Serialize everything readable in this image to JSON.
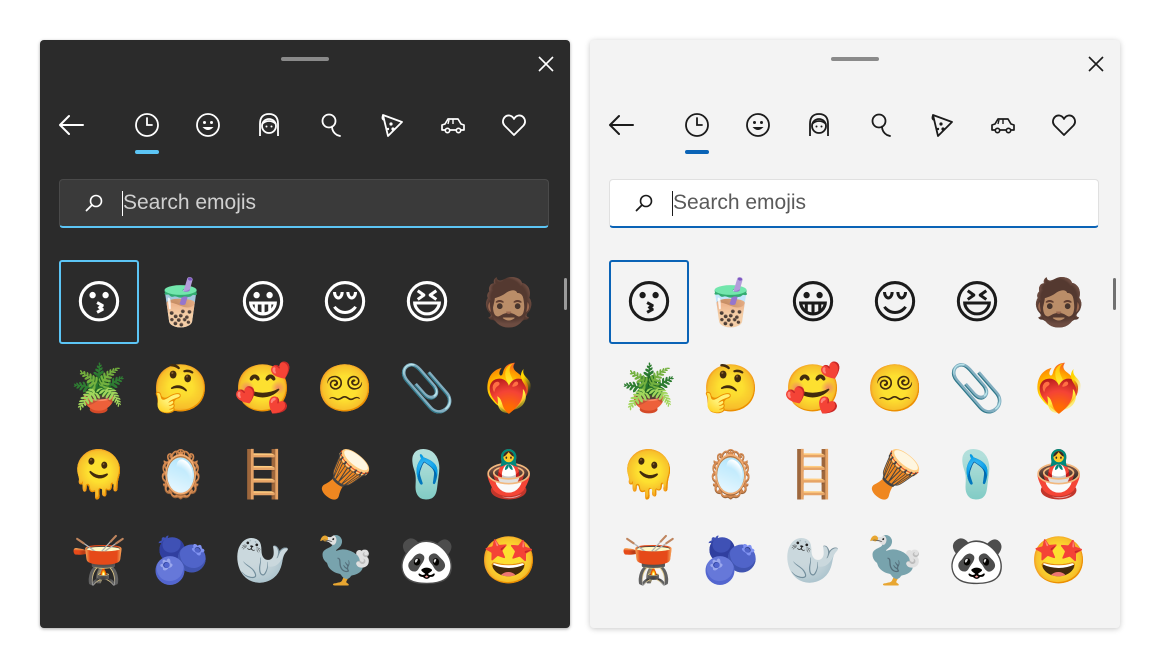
{
  "search": {
    "placeholder": "Search emojis"
  },
  "tabs": [
    {
      "icon": "recent-clock-icon",
      "selected": true
    },
    {
      "icon": "smiley-icon"
    },
    {
      "icon": "people-icon"
    },
    {
      "icon": "activities-icon"
    },
    {
      "icon": "food-icon"
    },
    {
      "icon": "travel-car-icon"
    },
    {
      "icon": "heart-symbols-icon"
    }
  ],
  "emojis": [
    "😗",
    "🧋",
    "😀",
    "😌",
    "😆",
    "🧔🏽",
    "🪴",
    "🤔",
    "🥰",
    "😵‍💫",
    "📎",
    "❤️‍🔥",
    "🫠",
    "🪞",
    "🪜",
    "🪘",
    "🩴",
    "🪆",
    "🫕",
    "🫐",
    "🦭",
    "🦤",
    "🐼",
    "🤩"
  ],
  "colors": {
    "dark_bg": "#2b2b2b",
    "light_bg": "#f3f3f3",
    "dark_accent": "#5cc5f5",
    "light_accent": "#0a63b6"
  }
}
